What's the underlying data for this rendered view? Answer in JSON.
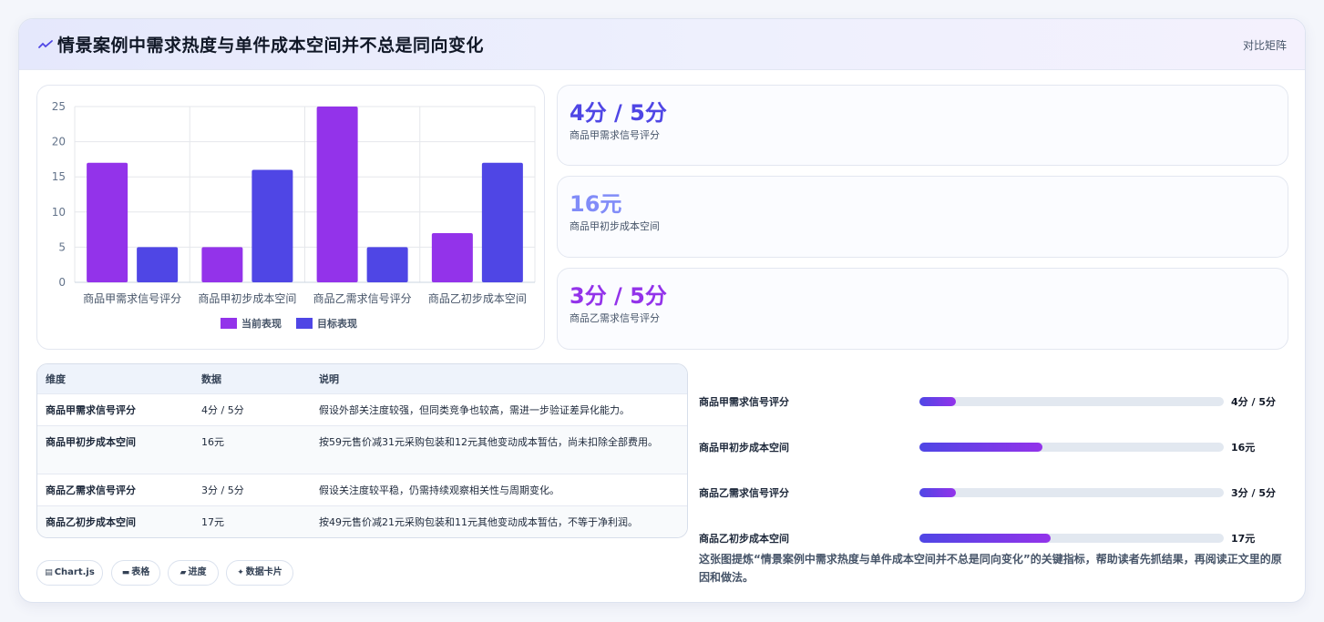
{
  "header": {
    "icon": "sparkline-icon",
    "title": "情景案例中需求热度与单件成本空间并不总是同向变化",
    "tag": "对比矩阵"
  },
  "chart_data": {
    "type": "bar",
    "categories": [
      "商品甲需求信号评分",
      "商品甲初步成本空间",
      "商品乙需求信号评分",
      "商品乙初步成本空间"
    ],
    "series": [
      {
        "name": "当前表现",
        "values": [
          17,
          5,
          25,
          7
        ],
        "color": "#9333ea"
      },
      {
        "name": "目标表现",
        "values": [
          5,
          16,
          5,
          17
        ],
        "color": "#4f46e5"
      }
    ],
    "ylim": [
      0,
      25
    ],
    "yticks": [
      "0",
      "5",
      "10",
      "15",
      "20",
      "25"
    ],
    "grid": true,
    "legend": "bottom"
  },
  "stats": [
    {
      "value": "4分 / 5分",
      "label": "商品甲需求信号评分",
      "color": "#4f46e5"
    },
    {
      "value": "16元",
      "label": "商品甲初步成本空间",
      "color": "#818cf8"
    },
    {
      "value": "3分 / 5分",
      "label": "商品乙需求信号评分",
      "color": "#9333ea"
    }
  ],
  "table": {
    "headers": [
      "维度",
      "数据",
      "说明"
    ],
    "rows": [
      [
        "商品甲需求信号评分",
        "4分 / 5分",
        "假设外部关注度较强，但同类竞争也较高，需进一步验证差异化能力。"
      ],
      [
        "商品甲初步成本空间",
        "16元",
        "按59元售价减31元采购包装和12元其他变动成本暂估，尚未扣除全部费用。"
      ],
      [
        "商品乙需求信号评分",
        "3分 / 5分",
        "假设关注度较平稳，仍需持续观察相关性与周期变化。"
      ],
      [
        "商品乙初步成本空间",
        "17元",
        "按49元售价减21元采购包装和11元其他变动成本暂估，不等于净利润。"
      ]
    ]
  },
  "progress": [
    {
      "label": "商品甲需求信号评分",
      "value": "4分 / 5分",
      "fraction": 0.12
    },
    {
      "label": "商品甲初步成本空间",
      "value": "16元",
      "fraction": 0.405
    },
    {
      "label": "商品乙需求信号评分",
      "value": "3分 / 5分",
      "fraction": 0.12
    },
    {
      "label": "商品乙初步成本空间",
      "value": "17元",
      "fraction": 0.43
    }
  ],
  "pills": [
    {
      "icon": "bar-chart-icon",
      "glyph": "▤",
      "label": "Chart.js"
    },
    {
      "icon": "table-icon",
      "glyph": "▬",
      "label": "表格"
    },
    {
      "icon": "progress-icon",
      "glyph": "▰",
      "label": "进度"
    },
    {
      "icon": "sparkle-icon",
      "glyph": "✦",
      "label": "数据卡片"
    }
  ],
  "caption": "这张图提炼“情景案例中需求热度与单件成本空间并不总是同向变化”的关键指标，帮助读者先抓结果，再阅读正文里的原因和做法。"
}
